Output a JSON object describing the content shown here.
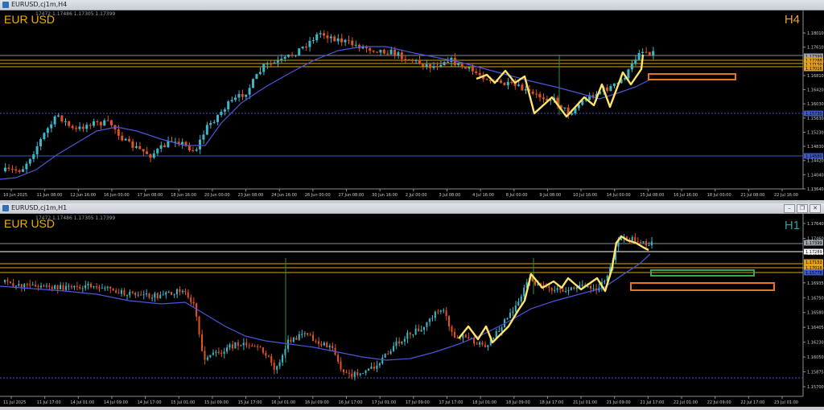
{
  "window_top": {
    "title": "EURUSD,cj1m,H4",
    "symbol_label": "EUR USD",
    "timeframe_label": "H4",
    "ohlc": "17472 1.17486 1.17305 1.17399",
    "price_ticks": [
      "1.18010",
      "1.17610",
      "1.17200",
      "1.16810",
      "1.16420",
      "1.16030",
      "1.15630",
      "1.15230",
      "1.14830",
      "1.14420",
      "1.14040",
      "1.13640"
    ],
    "date_ticks": [
      "10 Jun 2025",
      "11 Jun 08:00",
      "12 Jun 16:00",
      "16 Jun 00:00",
      "17 Jun 08:00",
      "18 Jun 16:00",
      "20 Jun 00:00",
      "23 Jun 08:00",
      "24 Jun 16:00",
      "26 Jun 00:00",
      "27 Jun 08:00",
      "30 Jun 16:00",
      "2 Jul 00:00",
      "3 Jul 08:00",
      "4 Jul 16:00",
      "8 Jul 00:00",
      "9 Jul 08:00",
      "10 Jul 16:00",
      "14 Jul 00:00",
      "15 Jul 08:00",
      "16 Jul 16:00",
      "18 Jul 00:00",
      "21 Jul 08:00",
      "22 Jul 16:00"
    ],
    "price_tags": [
      {
        "value": "1.17399",
        "color": "#9ea4ab"
      },
      {
        "value": "1.17288",
        "color": "#e3a21a"
      },
      {
        "value": "1.17150",
        "color": "#e3a21a"
      },
      {
        "value": "1.17016",
        "color": "#e3a21a"
      },
      {
        "value": "1.15730",
        "color": "#3d59c9"
      },
      {
        "value": "1.14580",
        "color": "#3d59c9"
      }
    ]
  },
  "window_bottom": {
    "title": "EURUSD,cj1m,H1",
    "symbol_label": "EUR USD",
    "timeframe_label": "H1",
    "ohlc": "17472 1.17486 1.17305 1.17399",
    "price_ticks": [
      "1.17640",
      "1.17460",
      "1.17300",
      "1.17120",
      "1.16935",
      "1.16750",
      "1.16580",
      "1.16405",
      "1.16230",
      "1.16050",
      "1.15875",
      "1.15700"
    ],
    "date_ticks": [
      "11 Jul 2025",
      "11 Jul 17:00",
      "14 Jul 01:00",
      "14 Jul 09:00",
      "14 Jul 17:00",
      "15 Jul 01:00",
      "15 Jul 09:00",
      "15 Jul 17:00",
      "16 Jul 01:00",
      "16 Jul 09:00",
      "16 Jul 17:00",
      "17 Jul 01:00",
      "17 Jul 09:00",
      "17 Jul 17:00",
      "18 Jul 01:00",
      "18 Jul 09:00",
      "18 Jul 17:00",
      "21 Jul 01:00",
      "21 Jul 09:00",
      "21 Jul 17:00",
      "22 Jul 01:00",
      "22 Jul 09:00",
      "22 Jul 17:00",
      "23 Jul 01:00"
    ],
    "price_tags": [
      {
        "value": "1.17399",
        "color": "#9ea4ab"
      },
      {
        "value": "1.17289",
        "color": "#ffffff"
      },
      {
        "value": "1.17152",
        "color": "#e3a21a"
      },
      {
        "value": "1.17016",
        "color": "#e3a21a"
      },
      {
        "value": "1.15778",
        "color": "#3d59c9"
      }
    ]
  },
  "colors": {
    "bull": "#3fb6c8",
    "bear": "#e0521f",
    "ma": "#4d56d8",
    "zigzag": "#ffe36b",
    "symbol": "#f0b000",
    "tf_top": "#f0a020",
    "tf_bottom": "#2aa198"
  }
}
